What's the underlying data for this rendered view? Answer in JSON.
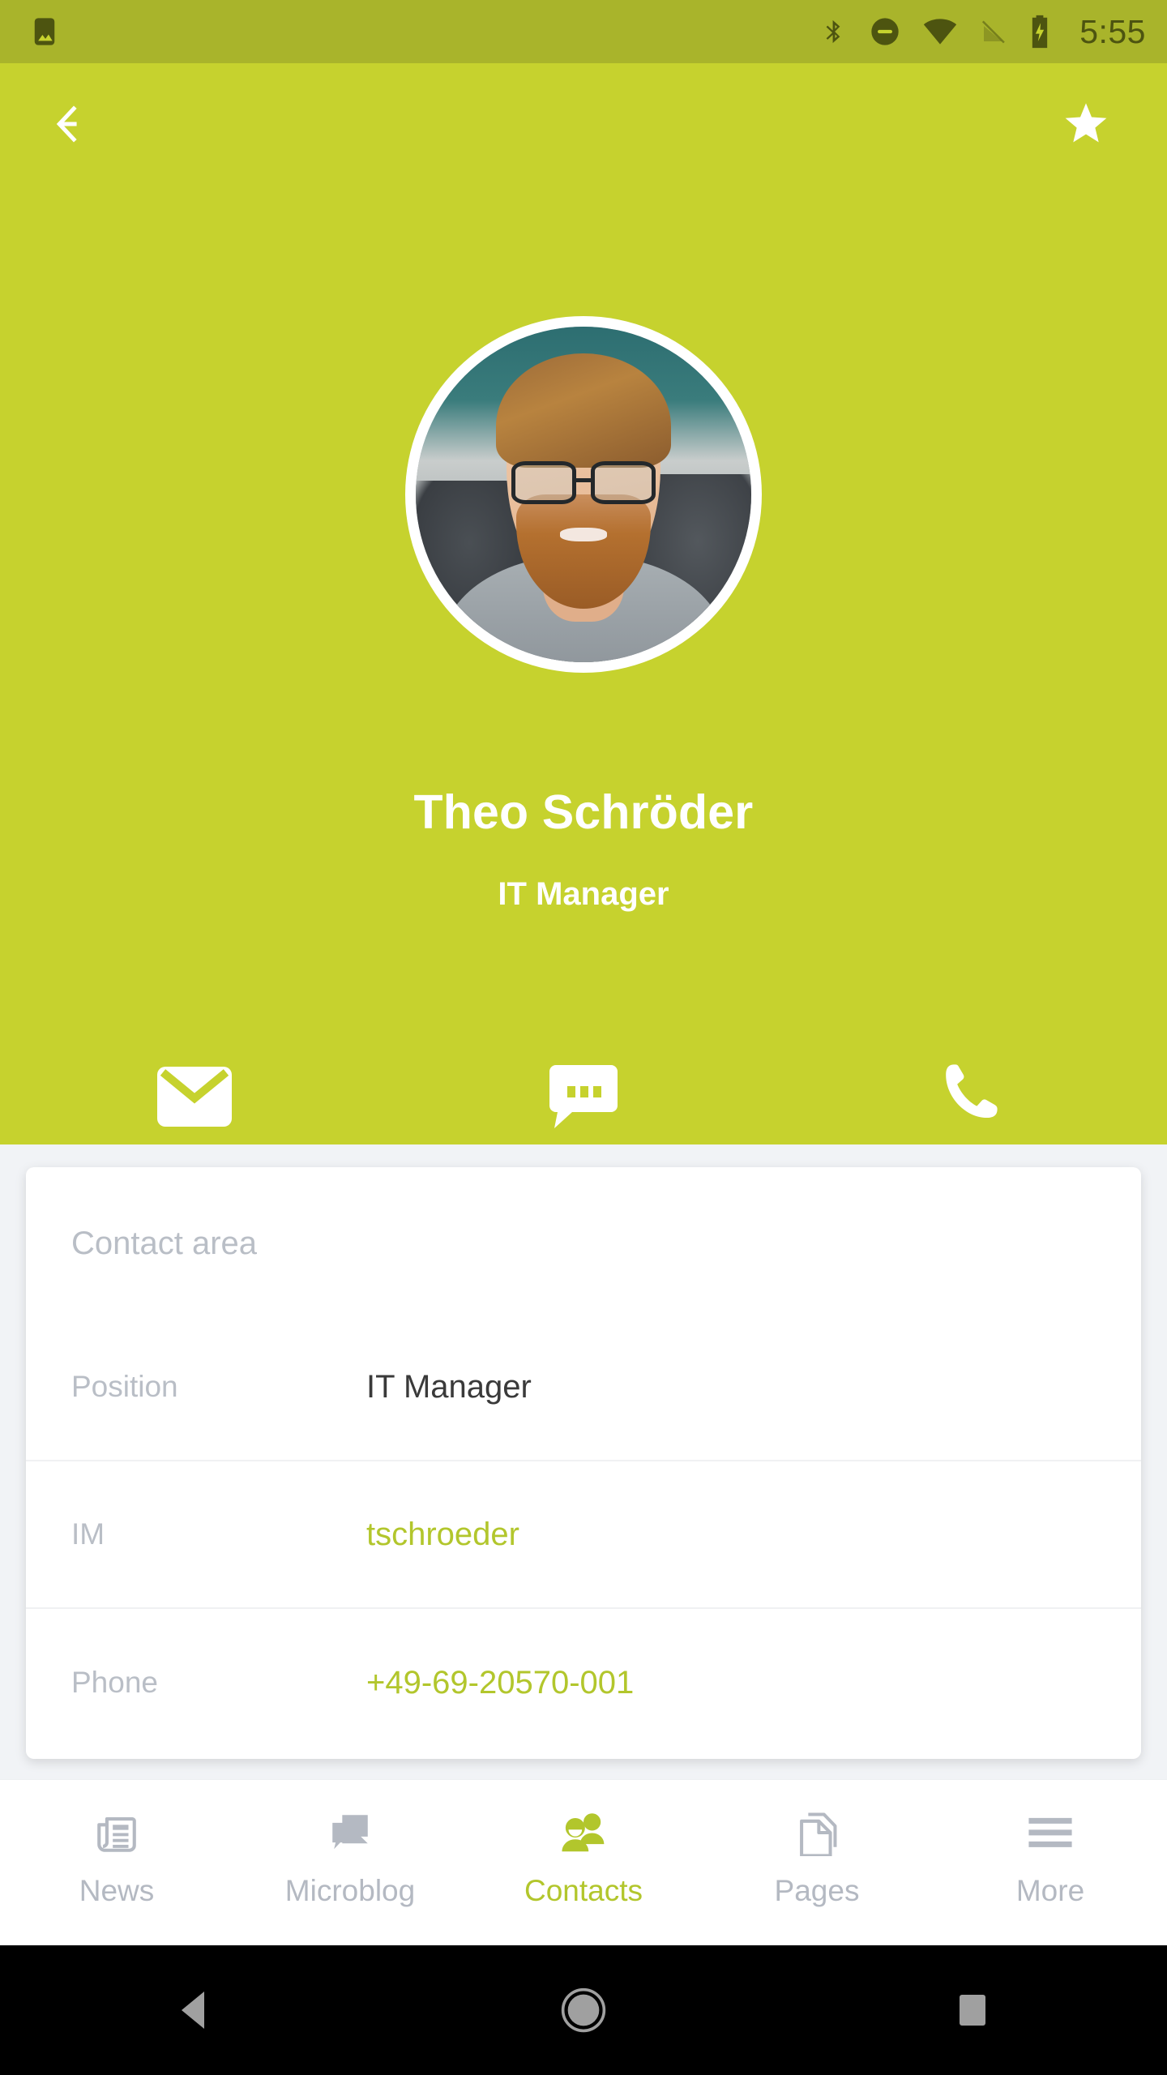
{
  "status_bar": {
    "time": "5:55",
    "notification_icon": "image-notification-icon",
    "icons": [
      "bluetooth-icon",
      "do-not-disturb-icon",
      "wifi-icon",
      "signal-off-icon",
      "battery-charging-icon"
    ],
    "background_color": "#A9B42B",
    "foreground_color": "#4D5410"
  },
  "app_bar": {
    "back_label": "Back",
    "favorite_label": "Favorite",
    "back_icon": "arrow-left-icon",
    "favorite_icon": "star-filled-icon"
  },
  "profile": {
    "name": "Theo Schröder",
    "role": "IT Manager",
    "avatar_alt": "Portrait of Theo Schröder",
    "header_color": "#C6D22E"
  },
  "quick_actions": [
    {
      "name": "email",
      "label": "Email",
      "icon": "envelope-icon"
    },
    {
      "name": "message",
      "label": "Message",
      "icon": "chat-bubble-icon"
    },
    {
      "name": "call",
      "label": "Call",
      "icon": "phone-icon"
    }
  ],
  "contact_card": {
    "title": "Contact area",
    "rows": [
      {
        "label": "Position",
        "value": "IT Manager",
        "type": "plain"
      },
      {
        "label": "IM",
        "value": "tschroeder",
        "type": "link"
      },
      {
        "label": "Phone",
        "value": "+49-69-20570-001",
        "type": "link"
      }
    ]
  },
  "bottom_tabs": [
    {
      "label": "News",
      "icon": "newspaper-icon",
      "active": false
    },
    {
      "label": "Microblog",
      "icon": "speech-bubbles-icon",
      "active": false
    },
    {
      "label": "Contacts",
      "icon": "people-icon",
      "active": true
    },
    {
      "label": "Pages",
      "icon": "document-icon",
      "active": false
    },
    {
      "label": "More",
      "icon": "hamburger-menu-icon",
      "active": false
    }
  ],
  "android_nav": [
    {
      "label": "Back",
      "icon": "triangle-back-icon"
    },
    {
      "label": "Home",
      "icon": "circle-home-icon"
    },
    {
      "label": "Recents",
      "icon": "square-recents-icon"
    }
  ],
  "colors": {
    "accent": "#B2C62C",
    "header": "#C6D22E",
    "status_bar": "#A9B42B",
    "page_background": "#F1F3F6",
    "card": "#FFFFFF",
    "muted_text": "#B9BEC6",
    "value_text": "#3A3A3A"
  }
}
